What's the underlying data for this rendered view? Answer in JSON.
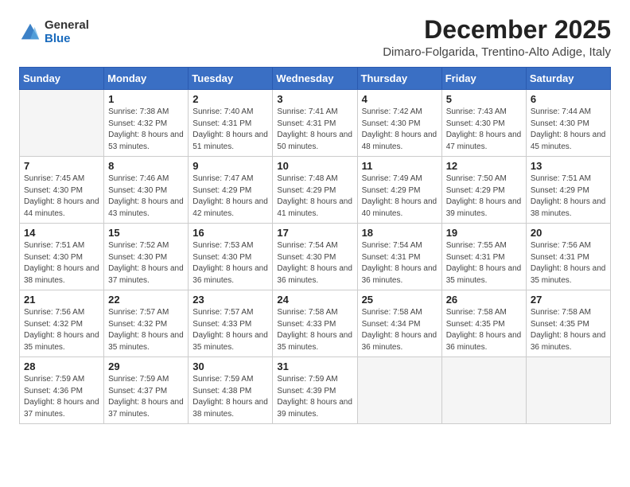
{
  "logo": {
    "general": "General",
    "blue": "Blue"
  },
  "title": "December 2025",
  "location": "Dimaro-Folgarida, Trentino-Alto Adige, Italy",
  "days_of_week": [
    "Sunday",
    "Monday",
    "Tuesday",
    "Wednesday",
    "Thursday",
    "Friday",
    "Saturday"
  ],
  "weeks": [
    [
      {
        "day": "",
        "sunrise": "",
        "sunset": "",
        "daylight": ""
      },
      {
        "day": "1",
        "sunrise": "Sunrise: 7:38 AM",
        "sunset": "Sunset: 4:32 PM",
        "daylight": "Daylight: 8 hours and 53 minutes."
      },
      {
        "day": "2",
        "sunrise": "Sunrise: 7:40 AM",
        "sunset": "Sunset: 4:31 PM",
        "daylight": "Daylight: 8 hours and 51 minutes."
      },
      {
        "day": "3",
        "sunrise": "Sunrise: 7:41 AM",
        "sunset": "Sunset: 4:31 PM",
        "daylight": "Daylight: 8 hours and 50 minutes."
      },
      {
        "day": "4",
        "sunrise": "Sunrise: 7:42 AM",
        "sunset": "Sunset: 4:30 PM",
        "daylight": "Daylight: 8 hours and 48 minutes."
      },
      {
        "day": "5",
        "sunrise": "Sunrise: 7:43 AM",
        "sunset": "Sunset: 4:30 PM",
        "daylight": "Daylight: 8 hours and 47 minutes."
      },
      {
        "day": "6",
        "sunrise": "Sunrise: 7:44 AM",
        "sunset": "Sunset: 4:30 PM",
        "daylight": "Daylight: 8 hours and 45 minutes."
      }
    ],
    [
      {
        "day": "7",
        "sunrise": "Sunrise: 7:45 AM",
        "sunset": "Sunset: 4:30 PM",
        "daylight": "Daylight: 8 hours and 44 minutes."
      },
      {
        "day": "8",
        "sunrise": "Sunrise: 7:46 AM",
        "sunset": "Sunset: 4:30 PM",
        "daylight": "Daylight: 8 hours and 43 minutes."
      },
      {
        "day": "9",
        "sunrise": "Sunrise: 7:47 AM",
        "sunset": "Sunset: 4:29 PM",
        "daylight": "Daylight: 8 hours and 42 minutes."
      },
      {
        "day": "10",
        "sunrise": "Sunrise: 7:48 AM",
        "sunset": "Sunset: 4:29 PM",
        "daylight": "Daylight: 8 hours and 41 minutes."
      },
      {
        "day": "11",
        "sunrise": "Sunrise: 7:49 AM",
        "sunset": "Sunset: 4:29 PM",
        "daylight": "Daylight: 8 hours and 40 minutes."
      },
      {
        "day": "12",
        "sunrise": "Sunrise: 7:50 AM",
        "sunset": "Sunset: 4:29 PM",
        "daylight": "Daylight: 8 hours and 39 minutes."
      },
      {
        "day": "13",
        "sunrise": "Sunrise: 7:51 AM",
        "sunset": "Sunset: 4:29 PM",
        "daylight": "Daylight: 8 hours and 38 minutes."
      }
    ],
    [
      {
        "day": "14",
        "sunrise": "Sunrise: 7:51 AM",
        "sunset": "Sunset: 4:30 PM",
        "daylight": "Daylight: 8 hours and 38 minutes."
      },
      {
        "day": "15",
        "sunrise": "Sunrise: 7:52 AM",
        "sunset": "Sunset: 4:30 PM",
        "daylight": "Daylight: 8 hours and 37 minutes."
      },
      {
        "day": "16",
        "sunrise": "Sunrise: 7:53 AM",
        "sunset": "Sunset: 4:30 PM",
        "daylight": "Daylight: 8 hours and 36 minutes."
      },
      {
        "day": "17",
        "sunrise": "Sunrise: 7:54 AM",
        "sunset": "Sunset: 4:30 PM",
        "daylight": "Daylight: 8 hours and 36 minutes."
      },
      {
        "day": "18",
        "sunrise": "Sunrise: 7:54 AM",
        "sunset": "Sunset: 4:31 PM",
        "daylight": "Daylight: 8 hours and 36 minutes."
      },
      {
        "day": "19",
        "sunrise": "Sunrise: 7:55 AM",
        "sunset": "Sunset: 4:31 PM",
        "daylight": "Daylight: 8 hours and 35 minutes."
      },
      {
        "day": "20",
        "sunrise": "Sunrise: 7:56 AM",
        "sunset": "Sunset: 4:31 PM",
        "daylight": "Daylight: 8 hours and 35 minutes."
      }
    ],
    [
      {
        "day": "21",
        "sunrise": "Sunrise: 7:56 AM",
        "sunset": "Sunset: 4:32 PM",
        "daylight": "Daylight: 8 hours and 35 minutes."
      },
      {
        "day": "22",
        "sunrise": "Sunrise: 7:57 AM",
        "sunset": "Sunset: 4:32 PM",
        "daylight": "Daylight: 8 hours and 35 minutes."
      },
      {
        "day": "23",
        "sunrise": "Sunrise: 7:57 AM",
        "sunset": "Sunset: 4:33 PM",
        "daylight": "Daylight: 8 hours and 35 minutes."
      },
      {
        "day": "24",
        "sunrise": "Sunrise: 7:58 AM",
        "sunset": "Sunset: 4:33 PM",
        "daylight": "Daylight: 8 hours and 35 minutes."
      },
      {
        "day": "25",
        "sunrise": "Sunrise: 7:58 AM",
        "sunset": "Sunset: 4:34 PM",
        "daylight": "Daylight: 8 hours and 36 minutes."
      },
      {
        "day": "26",
        "sunrise": "Sunrise: 7:58 AM",
        "sunset": "Sunset: 4:35 PM",
        "daylight": "Daylight: 8 hours and 36 minutes."
      },
      {
        "day": "27",
        "sunrise": "Sunrise: 7:58 AM",
        "sunset": "Sunset: 4:35 PM",
        "daylight": "Daylight: 8 hours and 36 minutes."
      }
    ],
    [
      {
        "day": "28",
        "sunrise": "Sunrise: 7:59 AM",
        "sunset": "Sunset: 4:36 PM",
        "daylight": "Daylight: 8 hours and 37 minutes."
      },
      {
        "day": "29",
        "sunrise": "Sunrise: 7:59 AM",
        "sunset": "Sunset: 4:37 PM",
        "daylight": "Daylight: 8 hours and 37 minutes."
      },
      {
        "day": "30",
        "sunrise": "Sunrise: 7:59 AM",
        "sunset": "Sunset: 4:38 PM",
        "daylight": "Daylight: 8 hours and 38 minutes."
      },
      {
        "day": "31",
        "sunrise": "Sunrise: 7:59 AM",
        "sunset": "Sunset: 4:39 PM",
        "daylight": "Daylight: 8 hours and 39 minutes."
      },
      {
        "day": "",
        "sunrise": "",
        "sunset": "",
        "daylight": ""
      },
      {
        "day": "",
        "sunrise": "",
        "sunset": "",
        "daylight": ""
      },
      {
        "day": "",
        "sunrise": "",
        "sunset": "",
        "daylight": ""
      }
    ]
  ]
}
